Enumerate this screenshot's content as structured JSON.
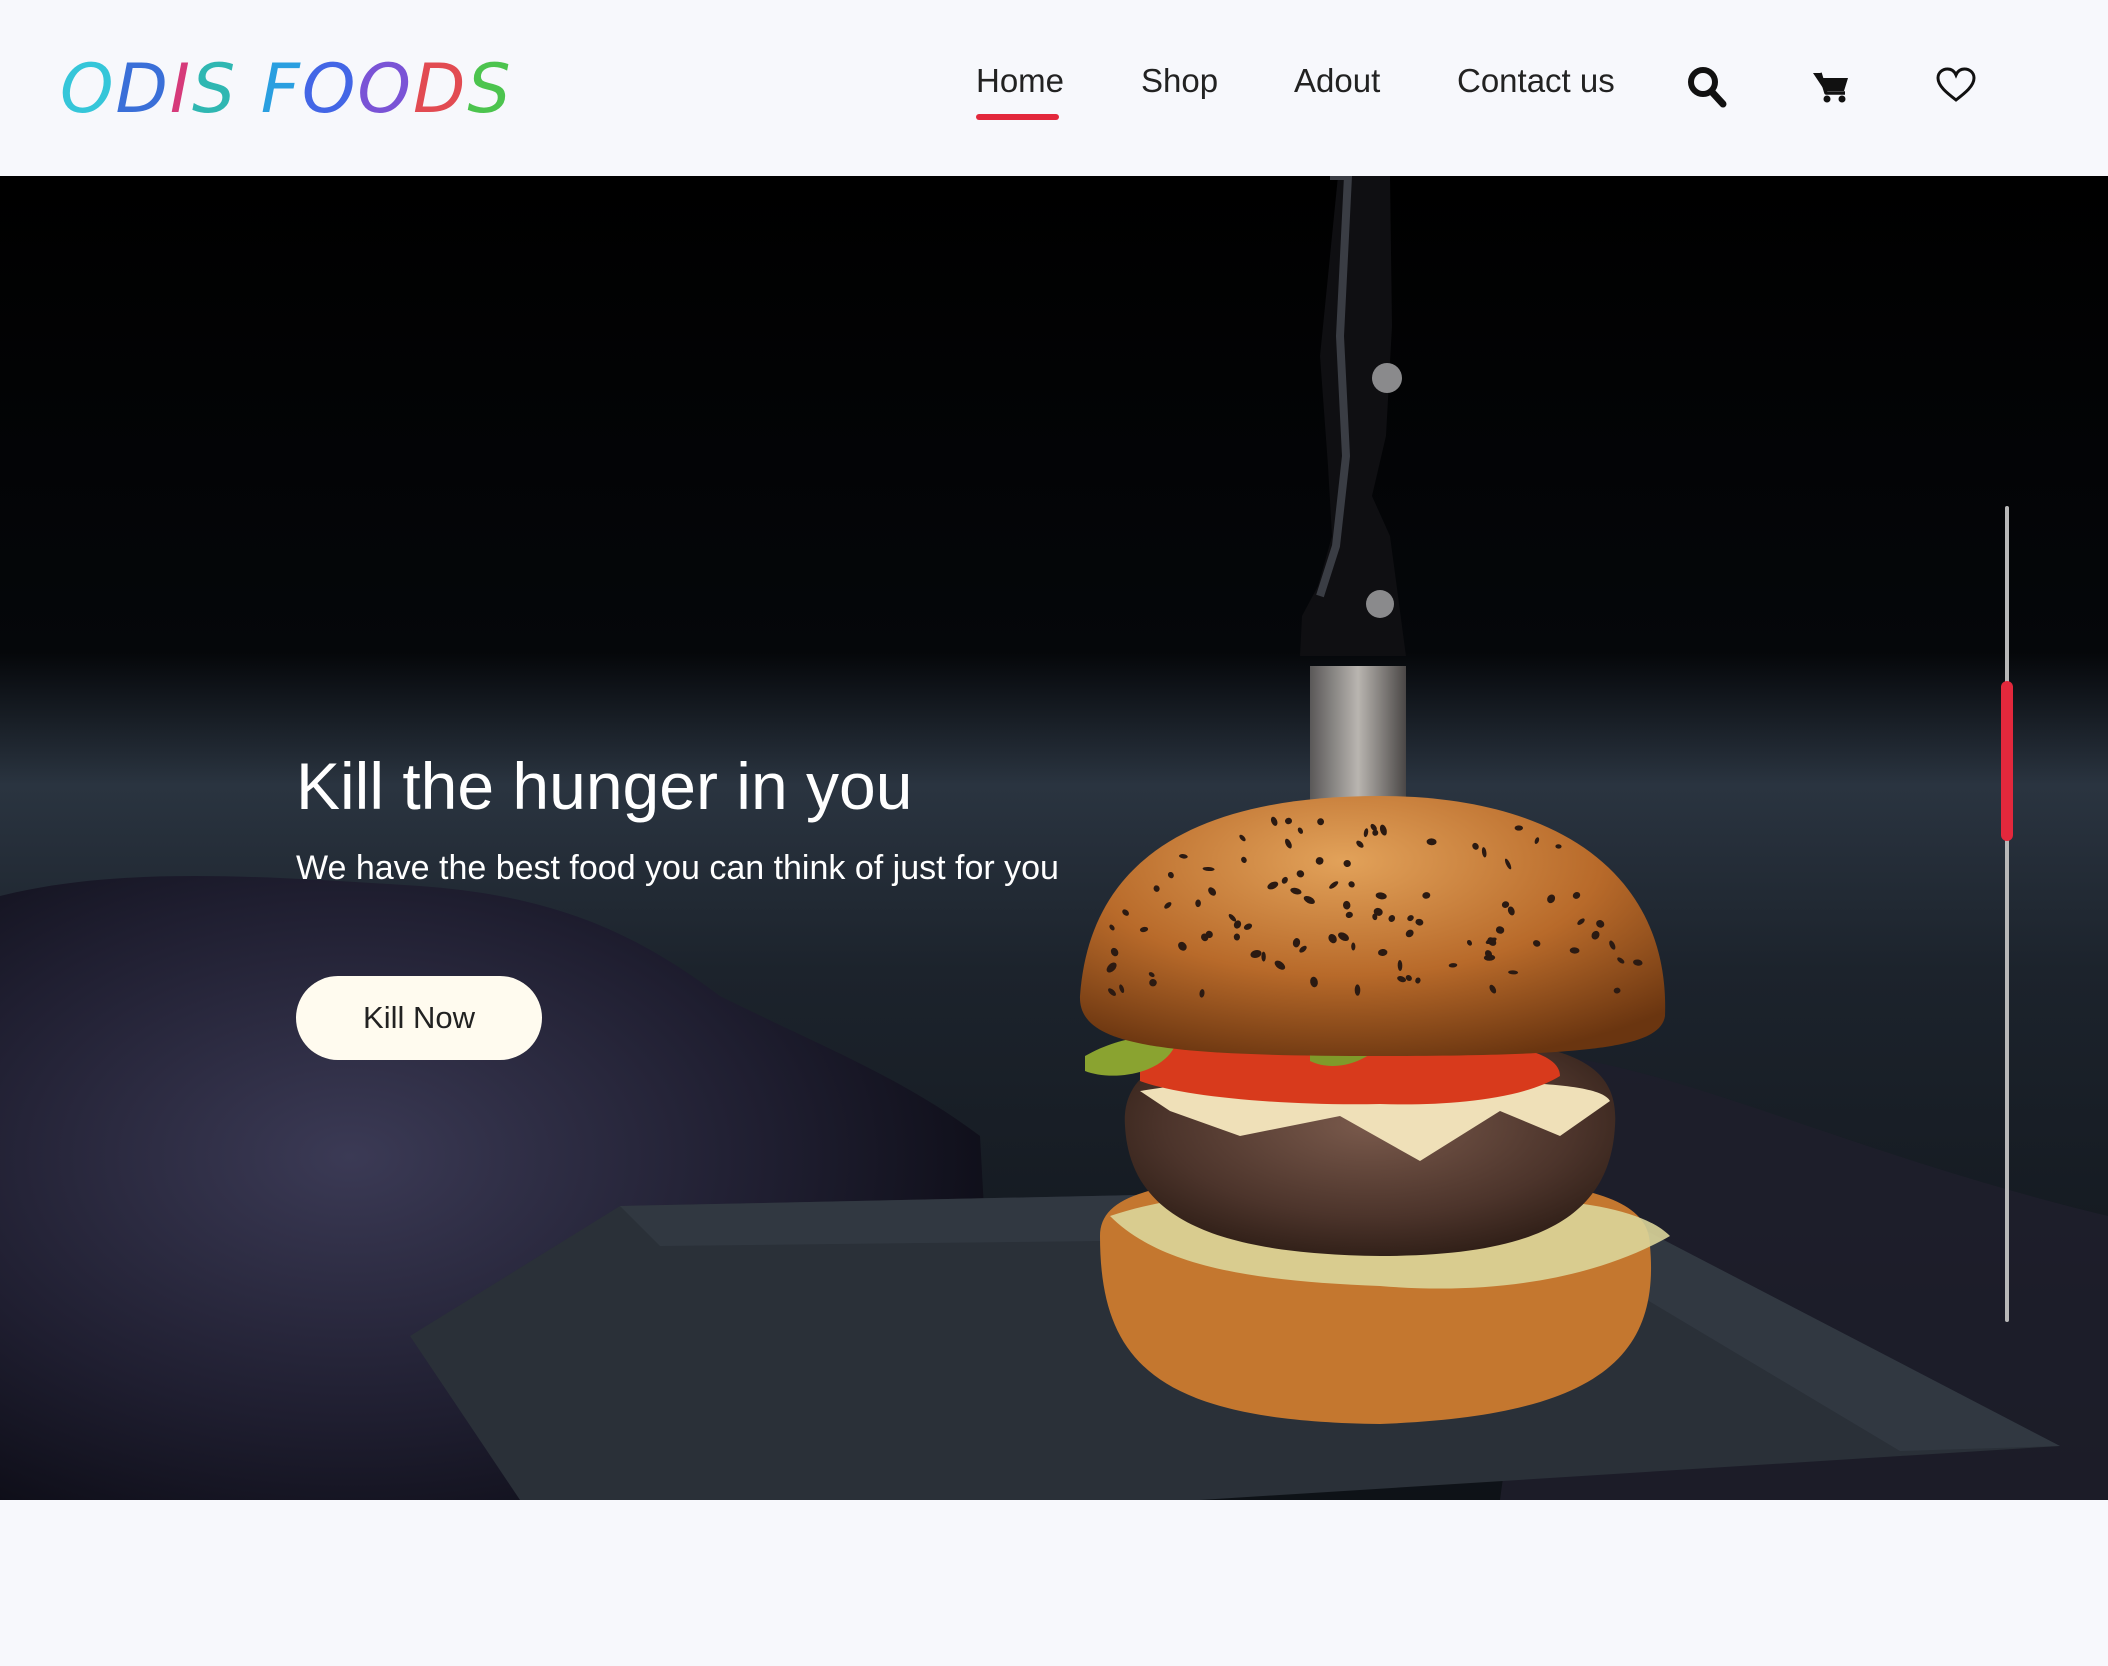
{
  "brand": {
    "logo_text": "ODIS FOODS",
    "letters": [
      {
        "ch": "O",
        "color": "#35c6d9"
      },
      {
        "ch": "D",
        "color": "#3a6fd8"
      },
      {
        "ch": "I",
        "color": "#d63a7a"
      },
      {
        "ch": "S",
        "color": "#2fb7b2"
      },
      {
        "ch": " ",
        "color": "#000000"
      },
      {
        "ch": "F",
        "color": "#2a9fe0"
      },
      {
        "ch": "O",
        "color": "#4366e6"
      },
      {
        "ch": "O",
        "color": "#7a53d6"
      },
      {
        "ch": "D",
        "color": "#e24b52"
      },
      {
        "ch": "S",
        "color": "#4cc44e"
      }
    ]
  },
  "nav": {
    "items": [
      {
        "label": "Home",
        "active": true
      },
      {
        "label": "Shop",
        "active": false
      },
      {
        "label": "Adout",
        "active": false
      },
      {
        "label": "Contact us",
        "active": false
      }
    ],
    "icons": [
      "search-icon",
      "cart-icon",
      "heart-icon"
    ]
  },
  "hero": {
    "title": "Kill the hunger in you",
    "subtitle": "We have the best food you can think of just for you",
    "cta_label": "Kill Now",
    "image": "burger-with-knife-photo"
  },
  "scroll_indicator": {
    "progress": 0.0
  },
  "colors": {
    "accent": "#e3283c",
    "header_bg": "#f7f8fc",
    "hero_bg": "#000000",
    "button_bg": "#fffbef"
  }
}
